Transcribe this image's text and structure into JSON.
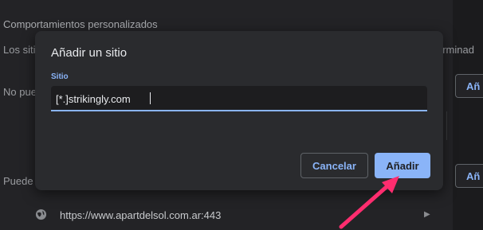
{
  "background": {
    "heading": "Comportamientos personalizados",
    "description_left": "Los siti",
    "description_right": "erminad",
    "row_no_pue": "No pue",
    "row_puede": "Puede s",
    "button_add_partial_1": "Añ",
    "button_add_partial_2": "Añ",
    "site_row_url": "https://www.apartdelsol.com.ar:443",
    "site_row_icon": "globe-icon",
    "site_row_chevron": "chevron-right-icon"
  },
  "dialog": {
    "title": "Añadir un sitio",
    "field_label": "Sitio",
    "field_value": "[*.]strikingly.com",
    "cancel_label": "Cancelar",
    "add_label": "Añadir"
  },
  "annotation": {
    "arrow_color": "#ff2d6f",
    "arrow_icon": "arrow-pointer-icon"
  },
  "colors": {
    "accent": "#8ab4f8",
    "dialog_bg": "#2a2b2e",
    "page_bg": "#232326"
  }
}
